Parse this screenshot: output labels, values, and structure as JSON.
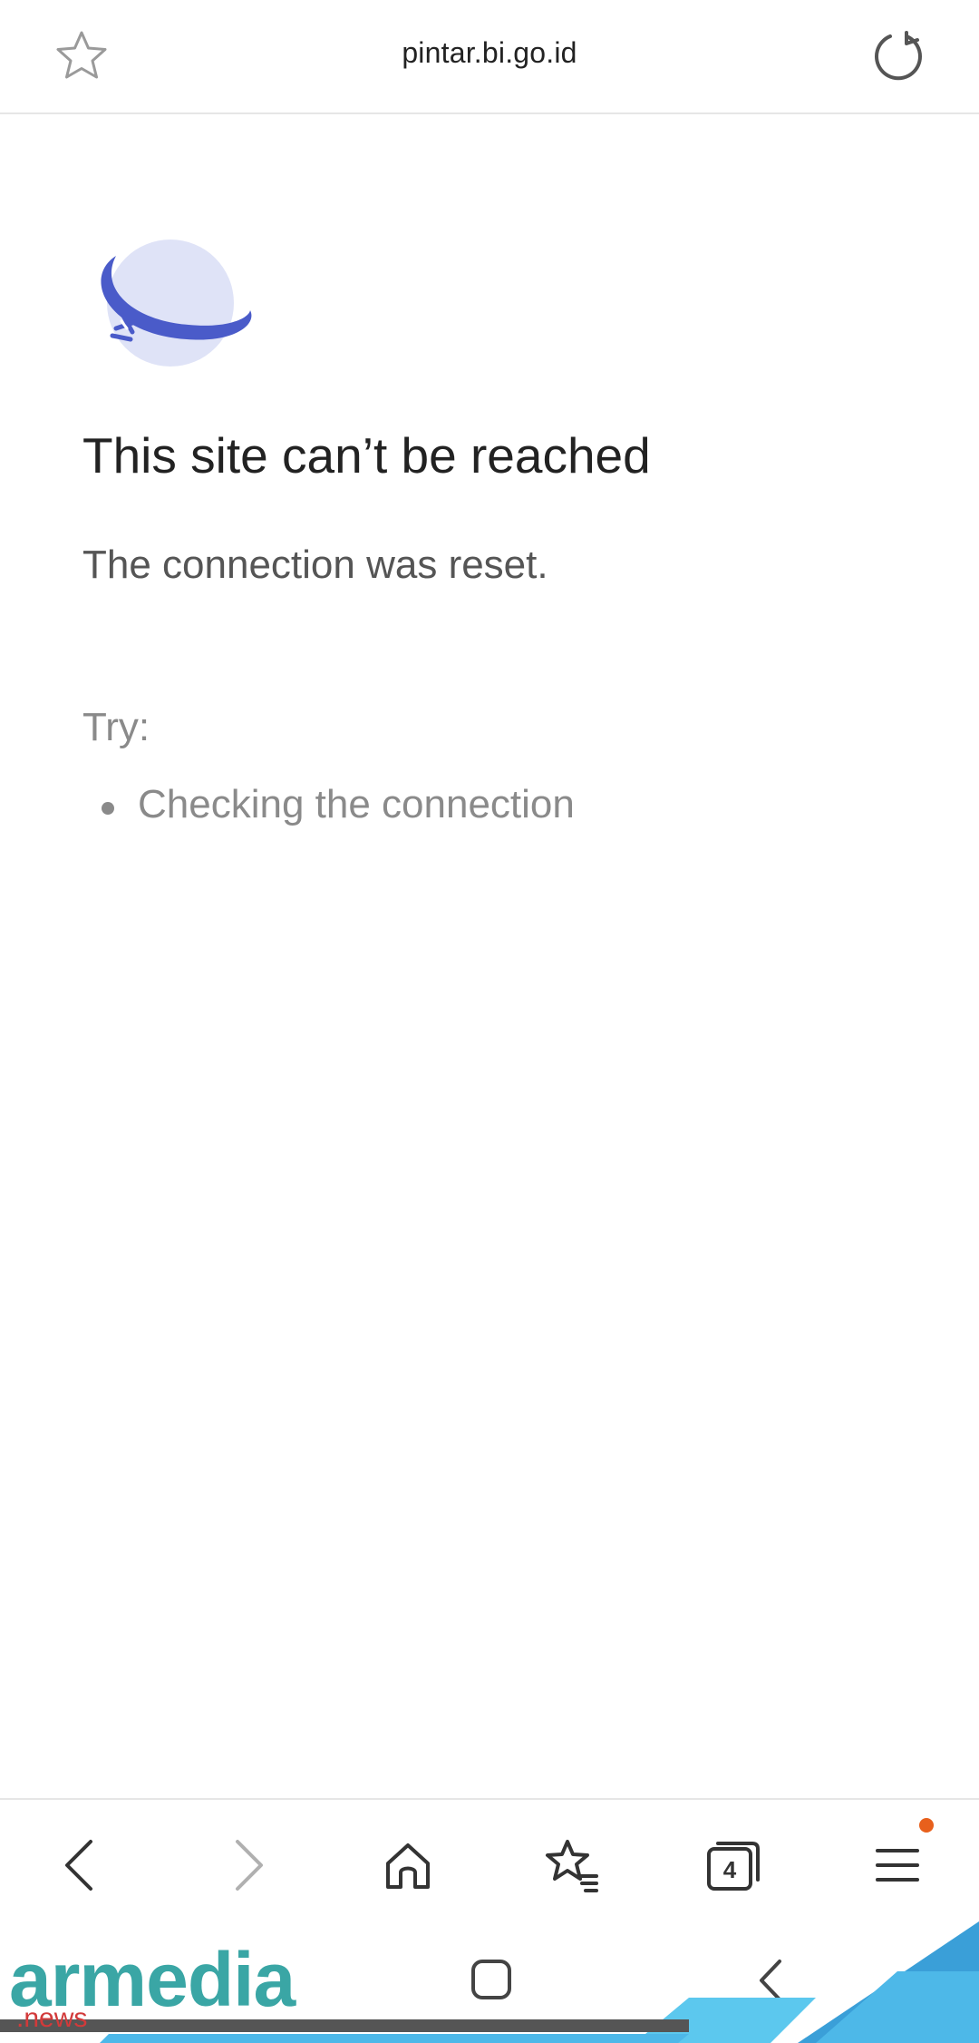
{
  "topbar": {
    "url": "pintar.bi.go.id",
    "bookmark_icon": "star-outline-icon",
    "reload_icon": "reload-icon"
  },
  "error": {
    "illustration": "planet-error-icon",
    "title": "This site can’t be reached",
    "message": "The connection was reset.",
    "try_label": "Try:",
    "suggestions": [
      "Checking the connection"
    ]
  },
  "bottom_toolbar": {
    "back_icon": "back-icon",
    "forward_icon": "forward-icon",
    "home_icon": "home-icon",
    "bookmarks_icon": "bookmarks-icon",
    "tabs_icon": "tabs-icon",
    "tabs_count": "4",
    "menu_icon": "menu-icon",
    "menu_has_notification": true,
    "notification_color": "#e8601c"
  },
  "system_nav": {
    "home_icon": "system-home-icon",
    "back_icon": "system-back-icon"
  },
  "watermark": {
    "brand": "armedia",
    "sub": ".news",
    "brand_color": "#3aa6a5",
    "sub_color": "#d23a3a",
    "accent_color": "#4db8e8"
  },
  "colors": {
    "globe_light": "#dfe3f7",
    "globe_ring": "#4a5bc9",
    "text_primary": "#222222",
    "text_secondary": "#555555",
    "text_muted": "#8a8a8a"
  }
}
